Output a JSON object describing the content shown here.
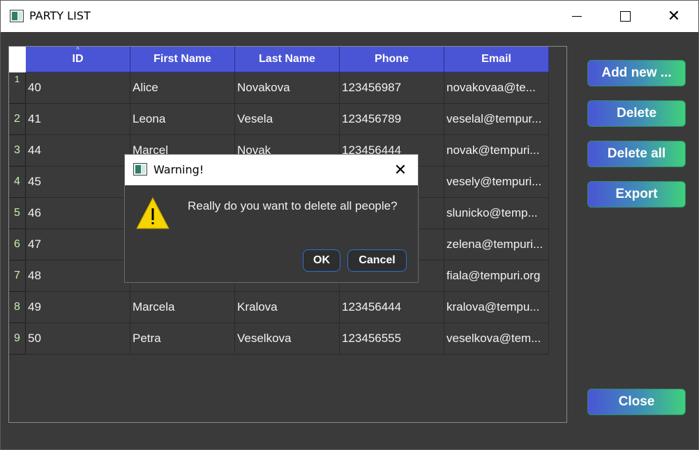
{
  "window": {
    "title": "PARTY LIST",
    "controls": {
      "minimize_icon": "minimize-icon",
      "maximize_icon": "maximize-icon",
      "close_icon": "close-icon",
      "close_glyph": "✕"
    }
  },
  "grid": {
    "columns": [
      "ID",
      "First Name",
      "Last Name",
      "Phone",
      "Email"
    ],
    "sort_glyph": "^",
    "rows": [
      {
        "num": "1",
        "id": "40",
        "first": "Alice",
        "last": "Novakova",
        "phone": "123456987",
        "email": "novakovaa@te..."
      },
      {
        "num": "2",
        "id": "41",
        "first": "Leona",
        "last": "Vesela",
        "phone": "123456789",
        "email": "veselal@tempur..."
      },
      {
        "num": "3",
        "id": "44",
        "first": "Marcel",
        "last": "Novak",
        "phone": "123456444",
        "email": "novak@tempuri..."
      },
      {
        "num": "4",
        "id": "45",
        "first": "",
        "last": "",
        "phone": "",
        "email": "vesely@tempuri..."
      },
      {
        "num": "5",
        "id": "46",
        "first": "",
        "last": "",
        "phone": "",
        "email": "slunicko@temp..."
      },
      {
        "num": "6",
        "id": "47",
        "first": "",
        "last": "",
        "phone": "",
        "email": "zelena@tempuri..."
      },
      {
        "num": "7",
        "id": "48",
        "first": "",
        "last": "",
        "phone": "",
        "email": "fiala@tempuri.org"
      },
      {
        "num": "8",
        "id": "49",
        "first": "Marcela",
        "last": "Kralova",
        "phone": "123456444",
        "email": "kralova@tempu..."
      },
      {
        "num": "9",
        "id": "50",
        "first": "Petra",
        "last": "Veselkova",
        "phone": "123456555",
        "email": "veselkova@tem..."
      }
    ]
  },
  "buttons": {
    "add_new": "Add new ...",
    "delete": "Delete",
    "delete_all": "Delete all",
    "export": "Export",
    "close": "Close"
  },
  "dialog": {
    "title": "Warning!",
    "close_glyph": "✕",
    "message": "Really do you want to delete all people?",
    "ok": "OK",
    "cancel": "Cancel",
    "icon": "warning-icon"
  },
  "colors": {
    "header_blue": "#4a55d6",
    "button_gradient_start": "#4a55d6",
    "button_gradient_end": "#3fd17a",
    "row_number": "#c7f0b0",
    "warning_yellow": "#f5d400"
  }
}
